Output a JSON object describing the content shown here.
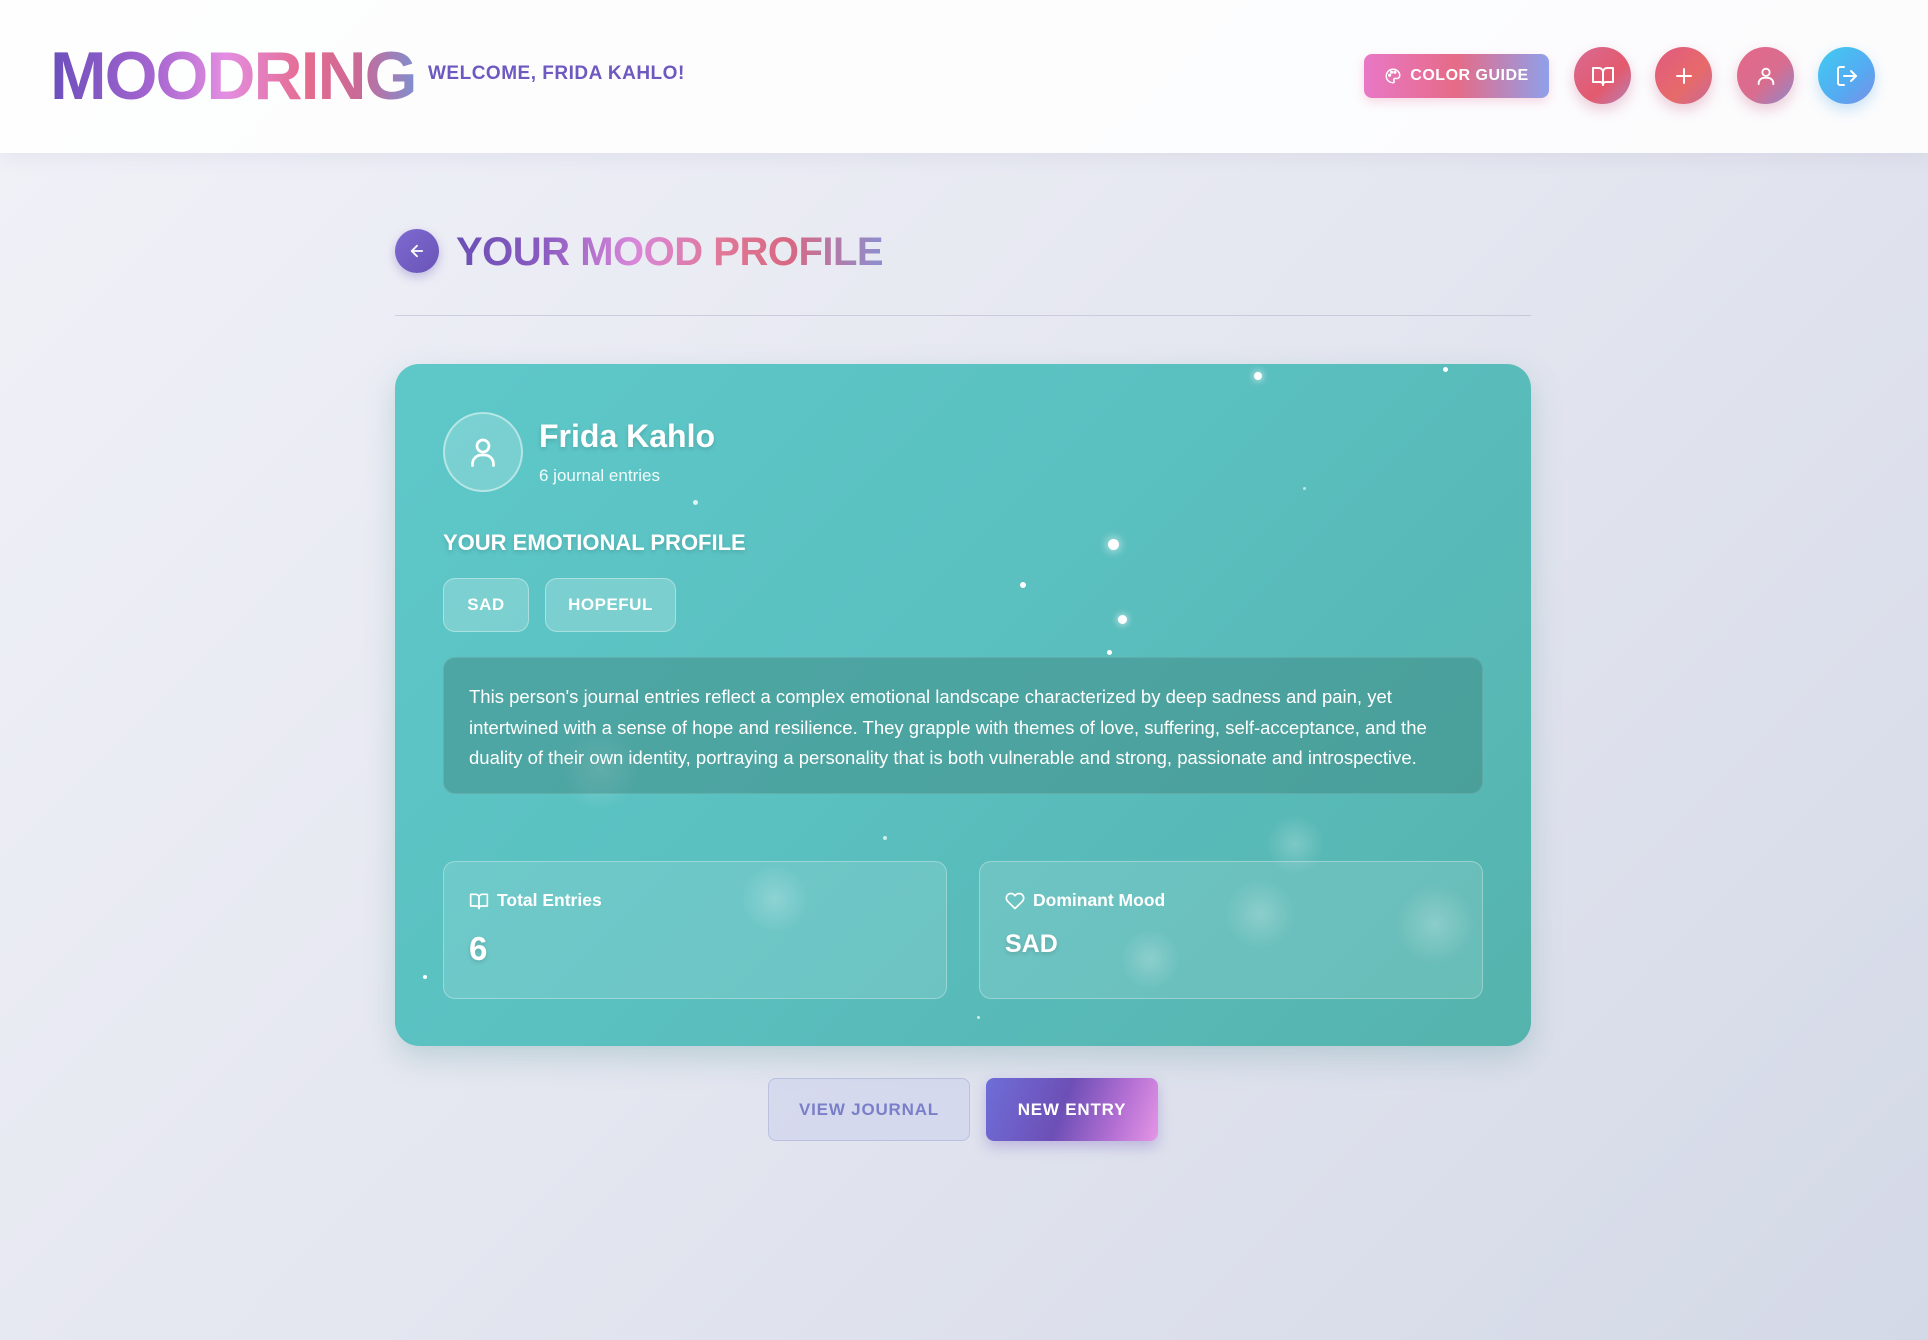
{
  "header": {
    "logo": "MOODRING",
    "welcome": "WELCOME, FRIDA KAHLO!",
    "color_guide_label": "COLOR GUIDE",
    "nav_buttons": [
      {
        "icon": "book-open-icon"
      },
      {
        "icon": "plus-icon"
      },
      {
        "icon": "user-icon"
      },
      {
        "icon": "logout-icon"
      }
    ]
  },
  "page": {
    "title_words": [
      "YOUR",
      "MOOD",
      "PROFILE"
    ],
    "back_icon": "arrow-left-icon"
  },
  "profile": {
    "name": "Frida Kahlo",
    "entry_count_text": "6 journal entries",
    "emotional_profile_heading": "YOUR EMOTIONAL PROFILE",
    "tags": [
      "SAD",
      "HOPEFUL"
    ],
    "summary": "This person's journal entries reflect a complex emotional landscape characterized by deep sadness and pain, yet intertwined with a sense of hope and resilience. They grapple with themes of love, suffering, self-acceptance, and the duality of their own identity, portraying a personality that is both vulnerable and strong, passionate and introspective.",
    "stats": {
      "total_entries": {
        "label": "Total Entries",
        "value": "6"
      },
      "dominant_mood": {
        "label": "Dominant Mood",
        "value": "SAD"
      }
    }
  },
  "actions": {
    "view_journal": "VIEW JOURNAL",
    "new_entry": "NEW ENTRY"
  },
  "colors": {
    "card_bg": "#5abfbf",
    "accent_purple": "#6e59c0",
    "accent_pink": "#e66b87",
    "logout_blue": "#3fcdf0"
  }
}
